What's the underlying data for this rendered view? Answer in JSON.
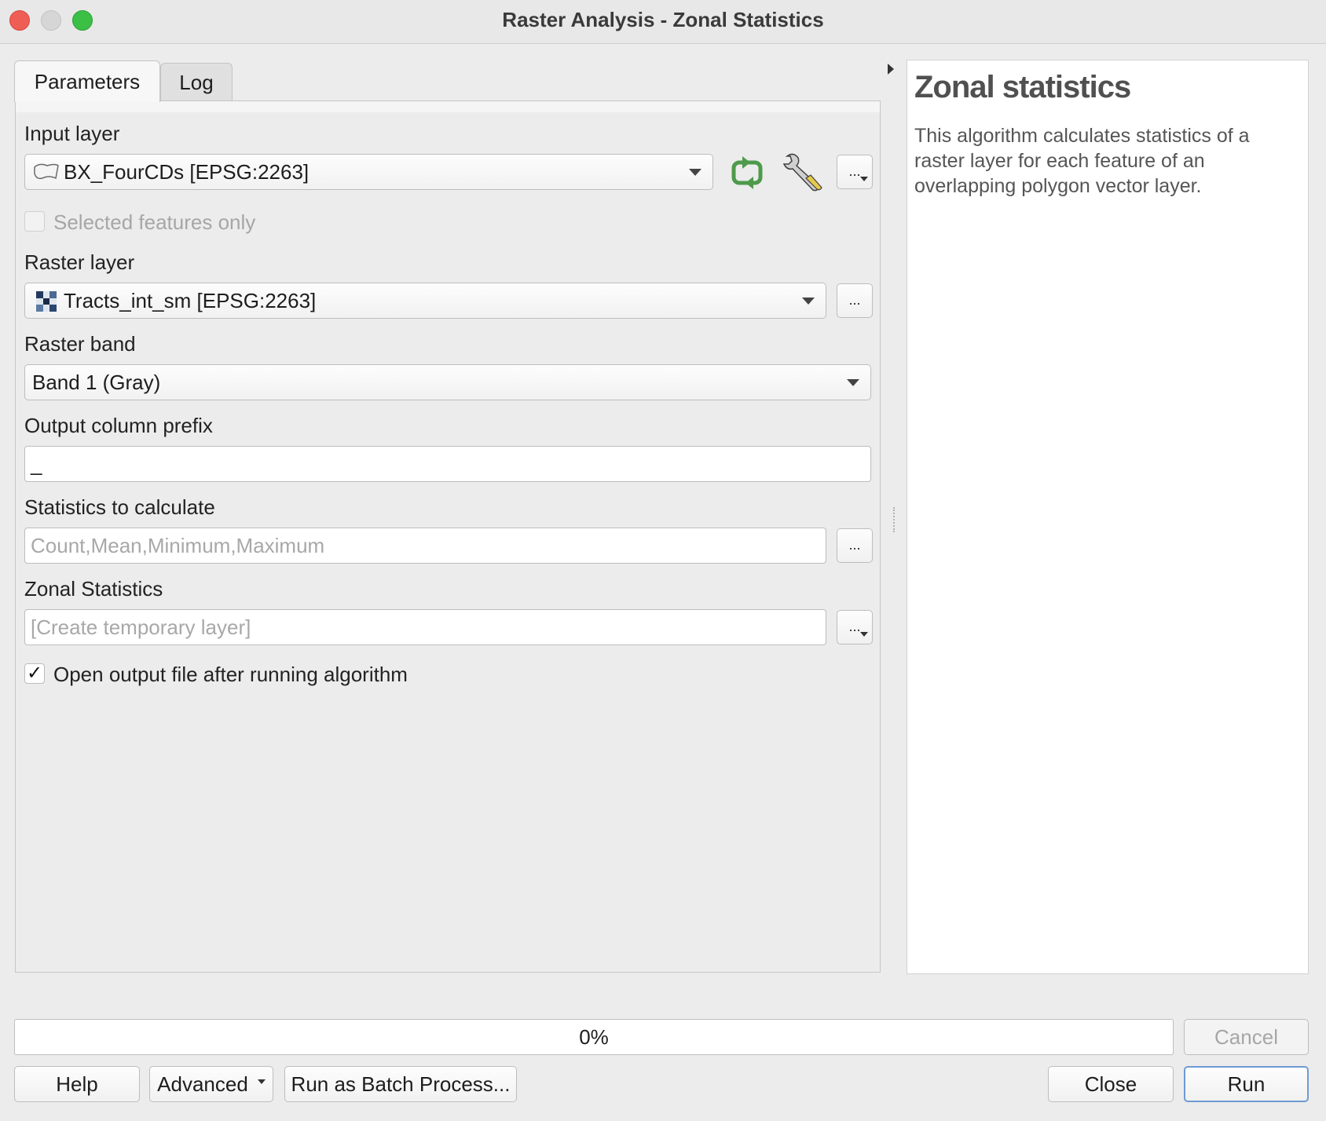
{
  "window": {
    "title": "Raster Analysis - Zonal Statistics"
  },
  "tabs": [
    {
      "label": "Parameters",
      "active": true
    },
    {
      "label": "Log",
      "active": false
    }
  ],
  "params": {
    "input_layer": {
      "label": "Input layer",
      "value": "BX_FourCDs [EPSG:2263]",
      "icon": "polygon-layer-icon"
    },
    "selected_only": {
      "label": "Selected features only",
      "checked": false,
      "enabled": false
    },
    "raster_layer": {
      "label": "Raster layer",
      "value": "Tracts_int_sm [EPSG:2263]",
      "icon": "raster-layer-icon"
    },
    "raster_band": {
      "label": "Raster band",
      "value": "Band 1 (Gray)"
    },
    "prefix": {
      "label": "Output column prefix",
      "value": "_"
    },
    "statistics": {
      "label": "Statistics to calculate",
      "placeholder": "Count,Mean,Minimum,Maximum"
    },
    "output": {
      "label": "Zonal Statistics",
      "placeholder": "[Create temporary layer]"
    },
    "open_output": {
      "label": "Open output file after running algorithm",
      "checked": true
    },
    "dots": "...",
    "checkmark": "✓"
  },
  "help": {
    "title": "Zonal statistics",
    "text": "This algorithm calculates statistics of a raster layer for each feature of an overlapping polygon vector layer."
  },
  "progress": {
    "value": 0,
    "text": "0%"
  },
  "buttons": {
    "cancel": "Cancel",
    "help": "Help",
    "advanced": "Advanced",
    "batch": "Run as Batch Process...",
    "close": "Close",
    "run": "Run"
  },
  "colors": {
    "close": "#ee5e55",
    "minimize": "#d6d6d6",
    "maximize": "#3bbf45",
    "iterate_icon": "#4e9a4b",
    "default_button_border": "#6e9bd3"
  }
}
